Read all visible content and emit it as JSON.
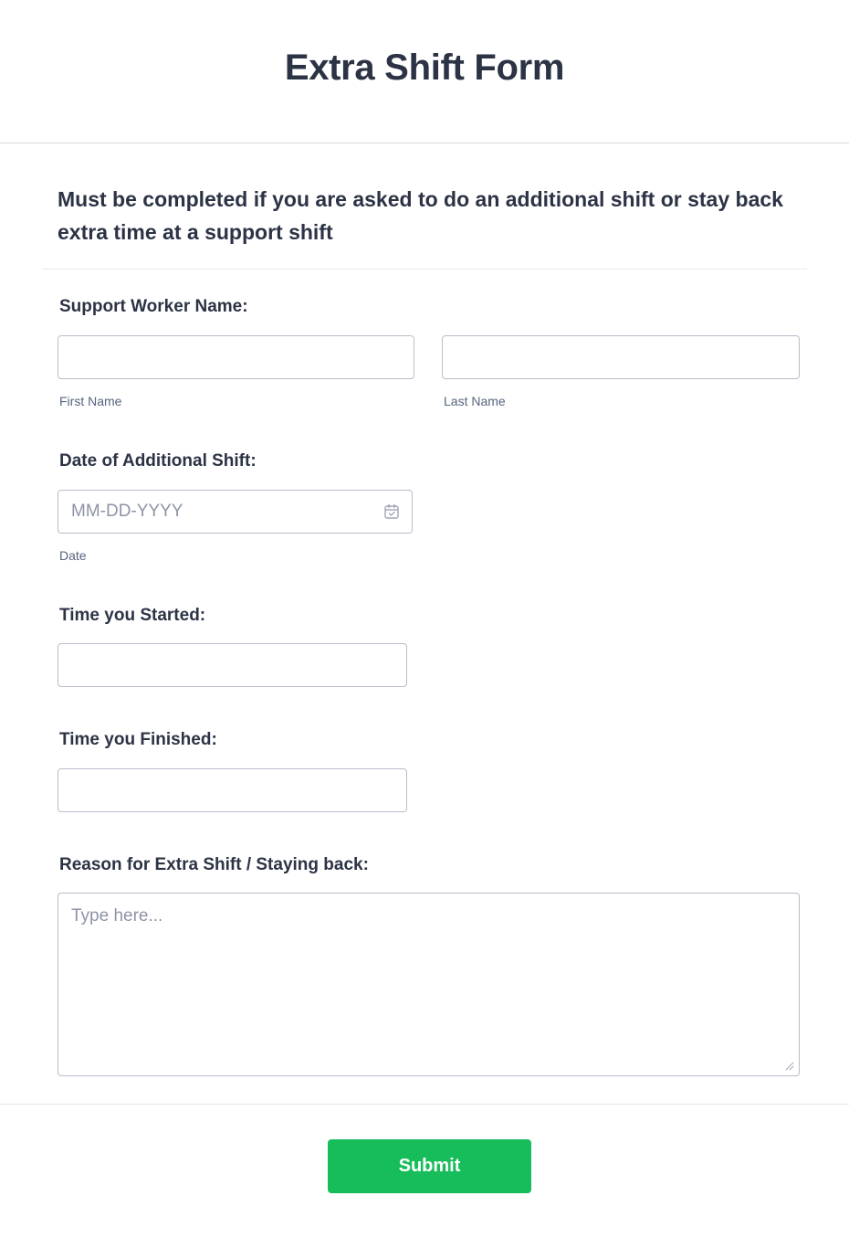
{
  "form": {
    "title": "Extra Shift Form",
    "subtitle": "Must be completed if you are asked to do an additional shift or stay back extra time at a support shift"
  },
  "fields": {
    "worker_name": {
      "label": "Support Worker Name:",
      "first_value": "",
      "first_sublabel": "First Name",
      "last_value": "",
      "last_sublabel": "Last Name"
    },
    "shift_date": {
      "label": "Date of Additional Shift:",
      "placeholder": "MM-DD-YYYY",
      "value": "",
      "sublabel": "Date",
      "icon": "calendar-icon"
    },
    "time_started": {
      "label": "Time you Started:",
      "value": ""
    },
    "time_finished": {
      "label": "Time you Finished:",
      "value": ""
    },
    "reason": {
      "label": "Reason for Extra Shift / Staying back:",
      "placeholder": "Type here...",
      "value": ""
    }
  },
  "actions": {
    "submit_label": "Submit"
  },
  "colors": {
    "submit_bg": "#18bd5b",
    "text": "#2c3345",
    "input_border": "#b8bdc9"
  }
}
